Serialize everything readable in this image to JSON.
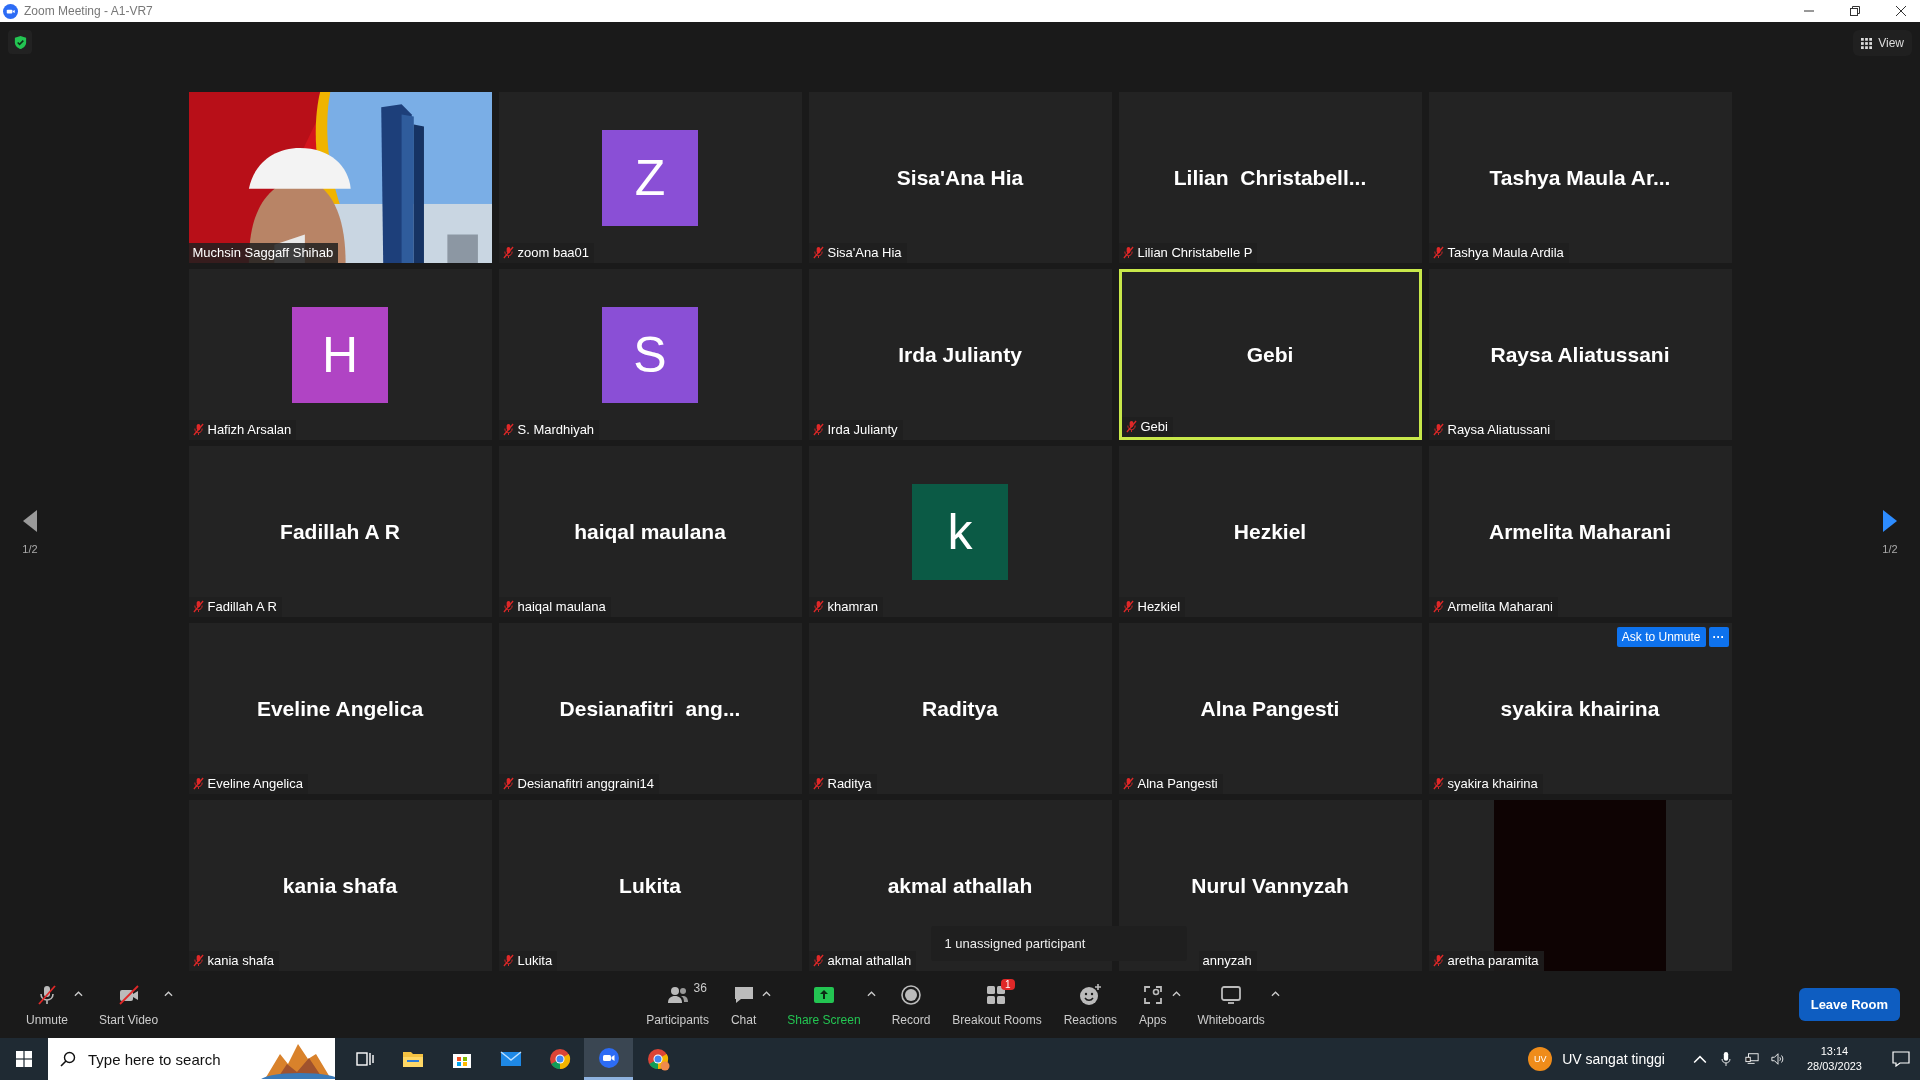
{
  "window": {
    "title": "Zoom Meeting - A1-VR7"
  },
  "view_button": {
    "label": "View"
  },
  "pager": {
    "left": {
      "label": "1/2",
      "enabled": false
    },
    "right": {
      "label": "1/2",
      "enabled": true
    }
  },
  "tiles": [
    {
      "kind": "video",
      "label": "Muchsin Saggaff Shihab",
      "muted": false,
      "speaking": false
    },
    {
      "kind": "avatar",
      "letter": "Z",
      "color": "#8a4fd6",
      "label": "zoom baa01",
      "muted": true,
      "speaking": false
    },
    {
      "kind": "name",
      "name": "Sisa'Ana Hia",
      "label": "Sisa'Ana Hia",
      "muted": true,
      "speaking": false
    },
    {
      "kind": "name",
      "name": "Lilian  Christabell...",
      "label": "Lilian Christabelle P",
      "muted": true,
      "speaking": false
    },
    {
      "kind": "name",
      "name": "Tashya Maula Ar...",
      "label": "Tashya Maula Ardila",
      "muted": true,
      "speaking": false
    },
    {
      "kind": "avatar",
      "letter": "H",
      "color": "#b044c4",
      "label": "Hafizh Arsalan",
      "muted": true,
      "speaking": false
    },
    {
      "kind": "avatar",
      "letter": "S",
      "color": "#8a4fd6",
      "label": "S. Mardhiyah",
      "muted": true,
      "speaking": false
    },
    {
      "kind": "name",
      "name": "Irda Julianty",
      "label": "Irda Julianty",
      "muted": true,
      "speaking": false
    },
    {
      "kind": "name",
      "name": "Gebi",
      "label": "Gebi",
      "muted": true,
      "speaking": true
    },
    {
      "kind": "name",
      "name": "Raysa Aliatussani",
      "label": "Raysa Aliatussani",
      "muted": true,
      "speaking": false
    },
    {
      "kind": "name",
      "name": "Fadillah A R",
      "label": "Fadillah A R",
      "muted": true,
      "speaking": false
    },
    {
      "kind": "name",
      "name": "haiqal maulana",
      "label": "haiqal maulana",
      "muted": true,
      "speaking": false
    },
    {
      "kind": "avatar",
      "letter": "k",
      "color": "#0b5a45",
      "label": "khamran",
      "muted": true,
      "speaking": false
    },
    {
      "kind": "name",
      "name": "Hezkiel",
      "label": "Hezkiel",
      "muted": true,
      "speaking": false
    },
    {
      "kind": "name",
      "name": "Armelita Maharani",
      "label": "Armelita Maharani",
      "muted": true,
      "speaking": false
    },
    {
      "kind": "name",
      "name": "Eveline Angelica",
      "label": "Eveline Angelica",
      "muted": true,
      "speaking": false
    },
    {
      "kind": "name",
      "name": "Desianafitri  ang...",
      "label": "Desianafitri anggraini14",
      "muted": true,
      "speaking": false
    },
    {
      "kind": "name",
      "name": "Raditya",
      "label": "Raditya",
      "muted": true,
      "speaking": false
    },
    {
      "kind": "name",
      "name": "Alna Pangesti",
      "label": "Alna Pangesti",
      "muted": true,
      "speaking": false
    },
    {
      "kind": "name",
      "name": "syakira khairina",
      "label": "syakira khairina",
      "muted": true,
      "speaking": false,
      "hover_actions": {
        "button": "Ask to Unmute",
        "more": "···"
      }
    },
    {
      "kind": "name",
      "name": "kania shafa",
      "label": "kania shafa",
      "muted": true,
      "speaking": false
    },
    {
      "kind": "name",
      "name": "Lukita",
      "label": "Lukita",
      "muted": true,
      "speaking": false
    },
    {
      "kind": "name",
      "name": "akmal athallah",
      "label": "akmal athallah",
      "muted": true,
      "speaking": false
    },
    {
      "kind": "name",
      "name": "Nurul Vannyzah",
      "label": "annyzah",
      "muted": false,
      "speaking": false,
      "covered": true
    },
    {
      "kind": "dark",
      "label": "aretha paramita",
      "muted": true,
      "speaking": false
    }
  ],
  "tooltip": {
    "text": "1 unassigned participant"
  },
  "toolbar": {
    "left": [
      {
        "kind": "mic",
        "label": "Unmute",
        "caret": true
      },
      {
        "kind": "camera",
        "label": "Start Video",
        "caret": true
      }
    ],
    "center": [
      {
        "kind": "participants",
        "label": "Participants",
        "count": "36"
      },
      {
        "kind": "chat",
        "label": "Chat",
        "caret": true
      },
      {
        "kind": "share",
        "label": "Share Screen",
        "caret": true
      },
      {
        "kind": "record",
        "label": "Record"
      },
      {
        "kind": "breakout",
        "label": "Breakout Rooms",
        "badge": "1"
      },
      {
        "kind": "reactions",
        "label": "Reactions"
      },
      {
        "kind": "apps",
        "label": "Apps",
        "caret": true
      },
      {
        "kind": "whiteboards",
        "label": "Whiteboards",
        "caret": true
      }
    ],
    "leave": "Leave Room"
  },
  "taskbar": {
    "search": {
      "placeholder": "Type here to search"
    },
    "apps": [
      {
        "kind": "taskview",
        "selected": false
      },
      {
        "kind": "explorer",
        "selected": false
      },
      {
        "kind": "store",
        "selected": false
      },
      {
        "kind": "mail",
        "selected": false
      },
      {
        "kind": "chrome",
        "selected": false
      },
      {
        "kind": "zoom",
        "selected": true
      },
      {
        "kind": "chrome-profile",
        "selected": false
      }
    ],
    "weather": {
      "badge": "UV",
      "text": "UV sangat tinggi"
    },
    "time": "13:14",
    "date": "28/03/2023"
  }
}
